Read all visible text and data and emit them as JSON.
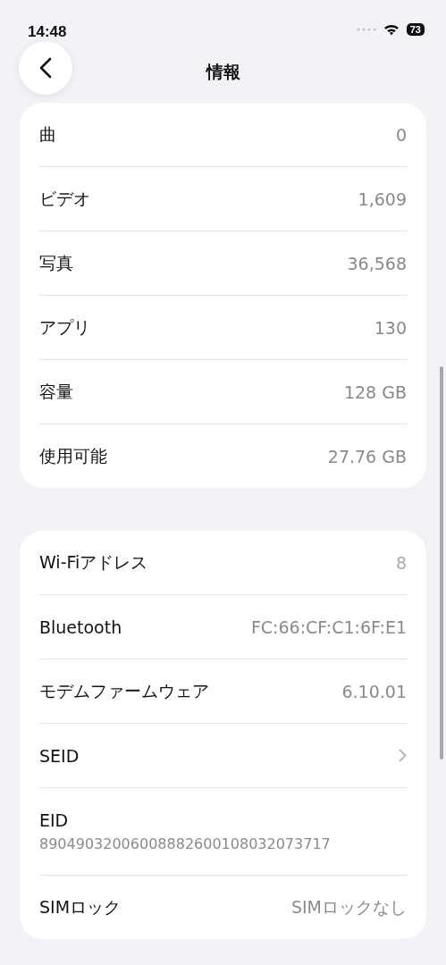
{
  "status_bar": {
    "time": "14:48",
    "battery": "73"
  },
  "nav": {
    "title": "情報"
  },
  "sections": [
    {
      "rows": [
        {
          "kind": "value",
          "label": "曲",
          "value": "0"
        },
        {
          "kind": "value",
          "label": "ビデオ",
          "value": "1,609"
        },
        {
          "kind": "value",
          "label": "写真",
          "value": "36,568"
        },
        {
          "kind": "value",
          "label": "アプリ",
          "value": "130"
        },
        {
          "kind": "value",
          "label": "容量",
          "value": "128 GB"
        },
        {
          "kind": "value",
          "label": "使用可能",
          "value": "27.76 GB"
        }
      ]
    },
    {
      "rows": [
        {
          "kind": "faded",
          "label": "Wi-Fiアドレス",
          "value": "8"
        },
        {
          "kind": "value",
          "label": "Bluetooth",
          "value": "FC:66:CF:C1:6F:E1"
        },
        {
          "kind": "value",
          "label": "モデムファームウェア",
          "value": "6.10.01"
        },
        {
          "kind": "chevron",
          "label": "SEID"
        },
        {
          "kind": "stacked",
          "label": "EID",
          "value": "89049032006008882600108032073717"
        },
        {
          "kind": "value",
          "label": "SIMロック",
          "value": "SIMロックなし"
        }
      ]
    }
  ]
}
